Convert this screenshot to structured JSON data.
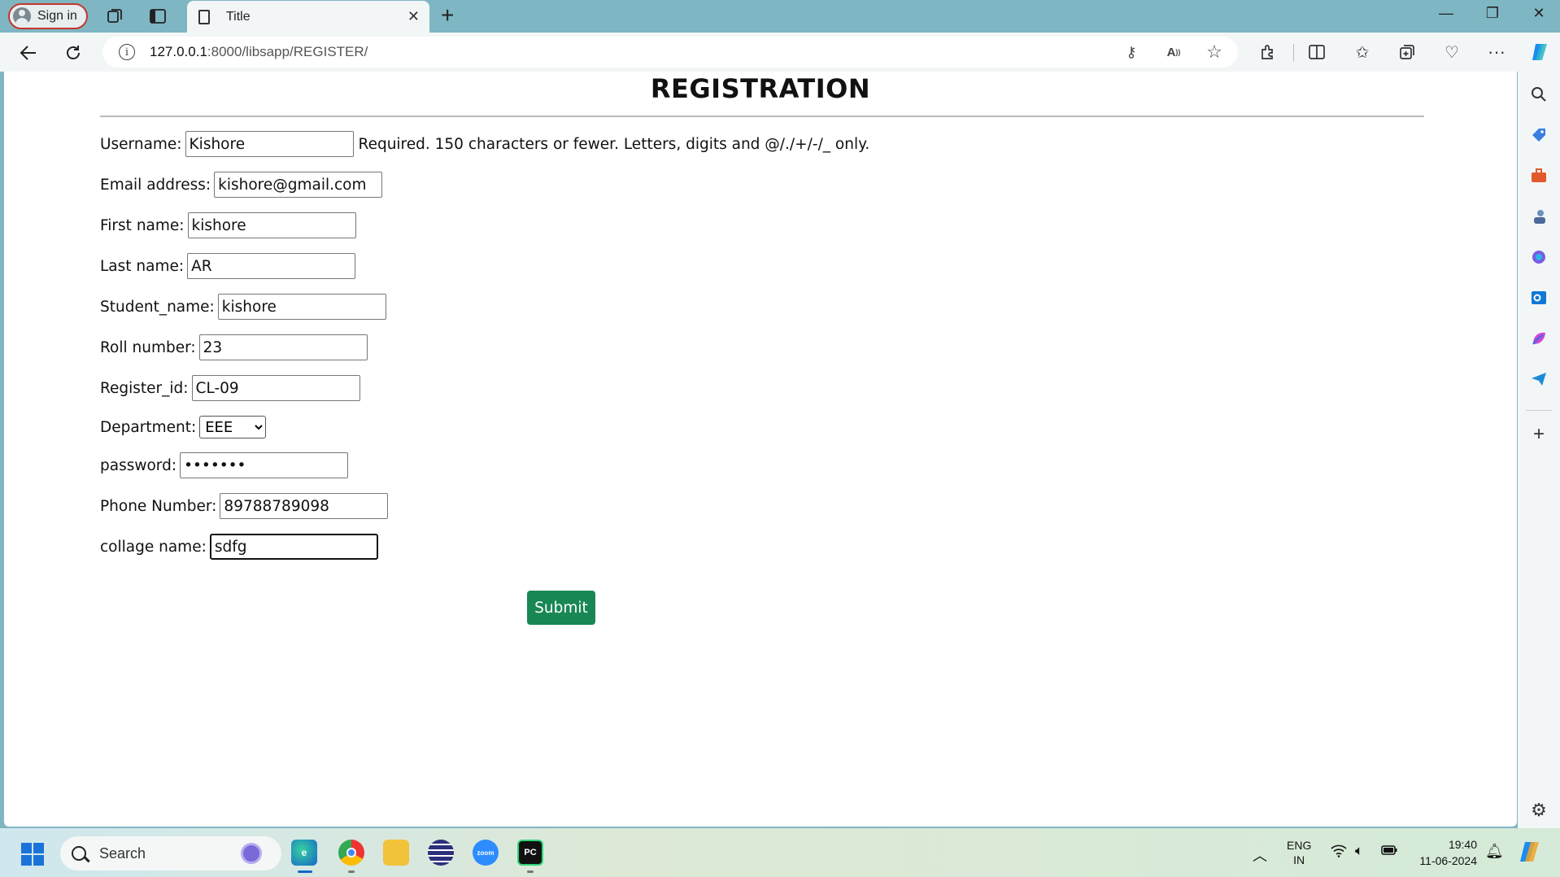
{
  "browser": {
    "signin_label": "Sign in",
    "tab_title": "Title",
    "url_host": "127.0.0.1",
    "url_path": ":8000/libsapp/REGISTER/"
  },
  "page": {
    "heading": "REGISTRATION",
    "fields": {
      "username": {
        "label": "Username:",
        "value": "Kishore",
        "help": "Required. 150 characters or fewer. Letters, digits and @/./+/-/_ only."
      },
      "email": {
        "label": "Email address:",
        "value": "kishore@gmail.com"
      },
      "first_name": {
        "label": "First name:",
        "value": "kishore"
      },
      "last_name": {
        "label": "Last name:",
        "value": "AR"
      },
      "student_name": {
        "label": "Student_name:",
        "value": "kishore"
      },
      "roll_number": {
        "label": "Roll number:",
        "value": "23"
      },
      "register_id": {
        "label": "Register_id:",
        "value": "CL-09"
      },
      "department": {
        "label": "Department:",
        "value": "EEE"
      },
      "password": {
        "label": "password:",
        "value": "•••••••"
      },
      "phone": {
        "label": "Phone Number:",
        "value": "89788789098"
      },
      "college": {
        "label": "collage name:",
        "value": "sdfg"
      }
    },
    "submit_label": "Submit"
  },
  "taskbar": {
    "search_placeholder": "Search",
    "lang_line1": "ENG",
    "lang_line2": "IN",
    "time": "19:40",
    "date": "11-06-2024"
  }
}
